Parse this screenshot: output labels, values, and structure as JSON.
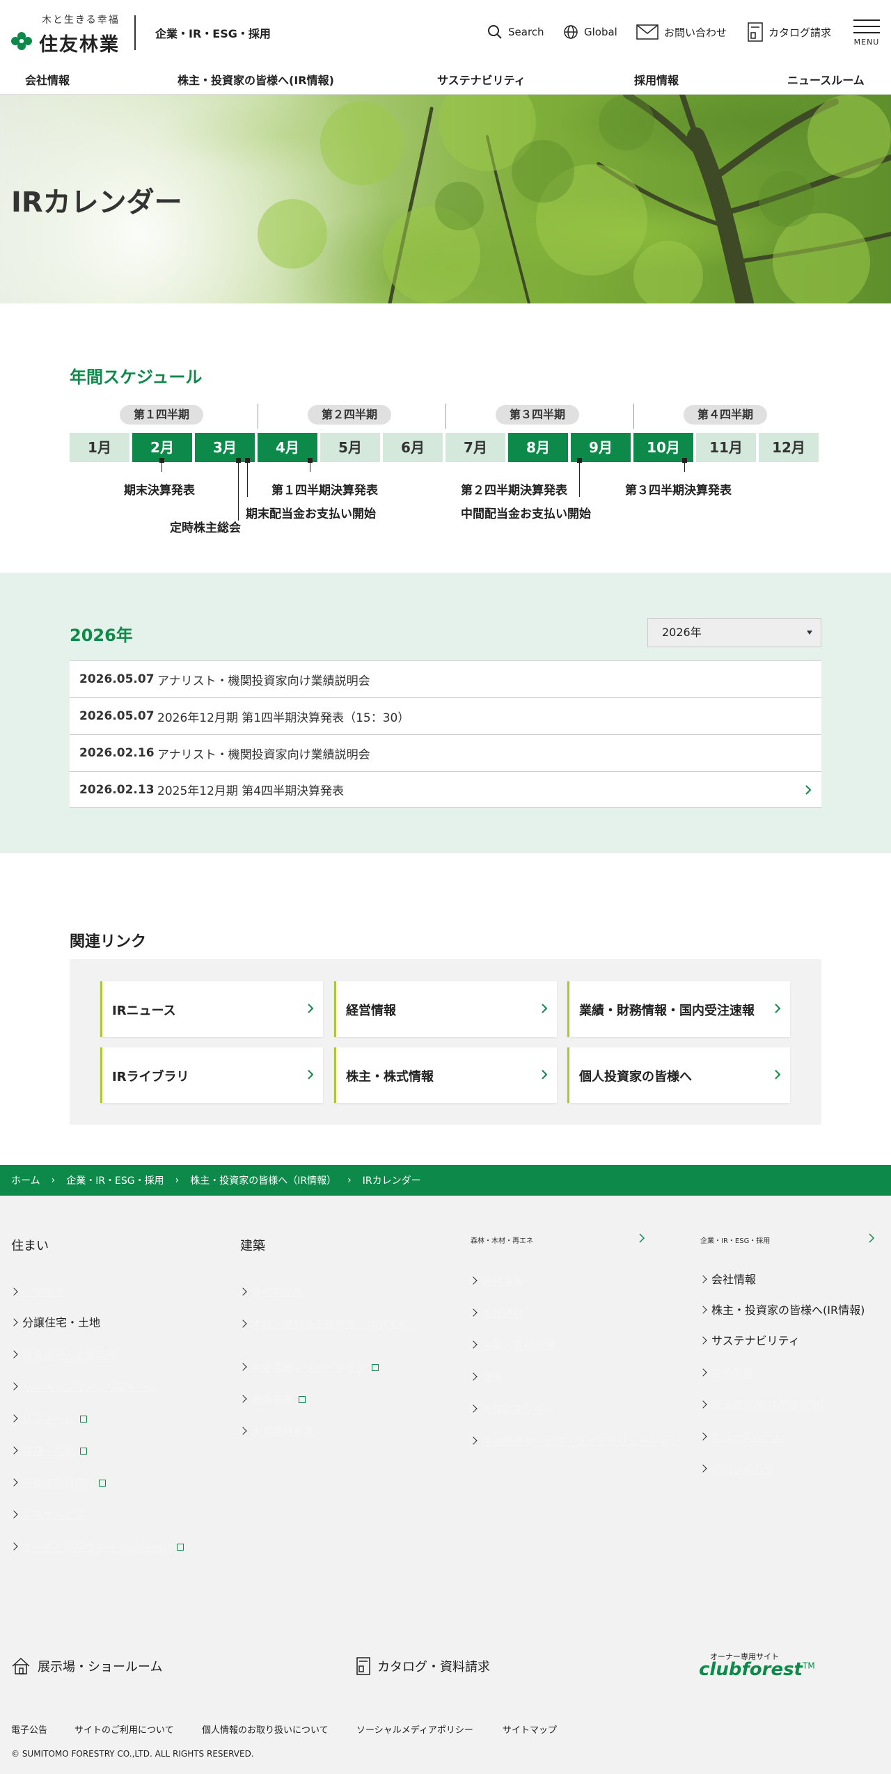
{
  "header": {
    "logo_tagline": "木と生きる幸福",
    "logo_name": "住友林業",
    "site_label": "企業・IR・ESG・採用",
    "search_label": "Search",
    "global_label": "Global",
    "contact_label": "お問い合わせ",
    "catalog_label": "カタログ請求",
    "menu_label": "MENU"
  },
  "nav": [
    "会社情報",
    "株主・投資家の皆様へ(IR情報)",
    "サステナビリティ",
    "採用情報",
    "ニュースルーム"
  ],
  "hero": {
    "title": "IRカレンダー"
  },
  "schedule": {
    "title": "年間スケジュール",
    "quarters": [
      "第１四半期",
      "第２四半期",
      "第３四半期",
      "第４四半期"
    ],
    "months": [
      "1月",
      "2月",
      "3月",
      "4月",
      "5月",
      "6月",
      "7月",
      "8月",
      "9月",
      "10月",
      "11月",
      "12月"
    ],
    "events": [
      "期末決算発表",
      "定時株主総会",
      "期末配当金お支払い開始",
      "第１四半期決算発表",
      "第２四半期決算発表",
      "中間配当金お支払い開始",
      "第３四半期決算発表"
    ]
  },
  "news": {
    "year_title": "2026年",
    "year_select": "2026年",
    "items": [
      {
        "date": "2026.05.07",
        "text": "アナリスト・機関投資家向け業績説明会"
      },
      {
        "date": "2026.05.07",
        "text": "2026年12月期 第1四半期決算発表（15：30）"
      },
      {
        "date": "2026.02.16",
        "text": "アナリスト・機関投資家向け業績説明会"
      },
      {
        "date": "2026.02.13",
        "text": "2025年12月期 第4四半期決算発表"
      }
    ]
  },
  "related": {
    "title": "関連リンク",
    "items": [
      "IRニュース",
      "経営情報",
      "業績・財務情報・国内受注速報",
      "IRライブラリ",
      "株主・株式情報",
      "個人投資家の皆様へ"
    ]
  },
  "breadcrumb": [
    "ホーム",
    "企業・IR・ESG・採用",
    "株主・投資家の皆様へ（IR情報）",
    "IRカレンダー"
  ],
  "footer": {
    "col1_title": "住まい",
    "col1_links": [
      "注文住宅",
      "分譲住宅・土地",
      "賃貸住宅・土地活用",
      "リノベーション・リフォーム",
      "リフォーム",
      "賃貸・売買",
      "不動産売買(別)",
      "住宅サービス",
      "オーナー専用サイト clubforest"
    ],
    "col2_title": "建築",
    "col2_links": [
      "非住宅建築",
      "木材・建材の流通事業（MOCCA）",
      "木造建築ソリューション",
      "海外事業",
      "木質建材事業"
    ],
    "col3_title": "森林・木材・再エネ",
    "col3_links": [
      "森林事業",
      "木材建材",
      "木質・建材流通",
      "環境",
      "木質エネルギー",
      "住宅関連サービス・ライフソリューション"
    ],
    "col4_title": "企業・IR・ESG・採用",
    "col4_links": [
      "会社情報",
      "株主・投資家の皆様へ(IR情報)",
      "サステナビリティ",
      "採用情報",
      "筑波研究所(技術研究所)",
      "ニュースルーム",
      "お問い合わせ"
    ],
    "bottom_items": [
      "展示場・ショールーム",
      "カタログ・資料請求"
    ],
    "clubforest_owner": "オーナー専用サイト",
    "clubforest_logo": "clubforest",
    "clubforest_tm": "TM",
    "legal_links": [
      "電子公告",
      "サイトのご利用について",
      "個人情報のお取り扱いについて",
      "ソーシャルメディアポリシー",
      "サイトマップ"
    ],
    "copyright": "© SUMITOMO FORESTRY CO.,LTD. ALL RIGHTS RESERVED."
  },
  "colors": {
    "brand_green": "#0d8a4a",
    "light_green": "#d4e9dc",
    "news_band": "#e5f2eb"
  }
}
